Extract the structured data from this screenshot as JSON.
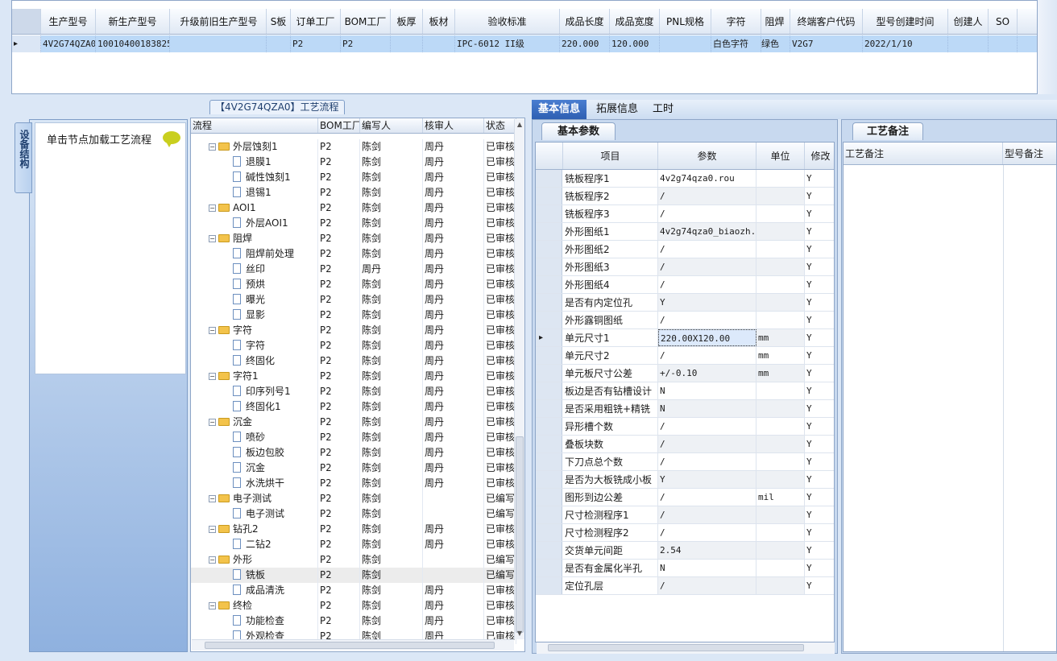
{
  "top_grid": {
    "headers": [
      "生产型号",
      "新生产型号",
      "升级前旧生产型号",
      "S板",
      "订单工厂",
      "BOM工厂",
      "板厚",
      "板材",
      "验收标准",
      "成品长度",
      "成品宽度",
      "PNL规格",
      "字符",
      "阻焊",
      "终端客户代码",
      "型号创建时间",
      "创建人",
      "SO"
    ],
    "row": [
      "4V2G74QZA0",
      "10010400183825",
      "",
      "",
      "P2",
      "P2",
      "",
      "",
      "IPC-6012 II级",
      "220.000",
      "120.000",
      "",
      "白色字符",
      "绿色",
      "V2G7",
      "2022/1/10",
      "",
      ""
    ]
  },
  "sidebar": {
    "tab_label": "设备结构",
    "hint_text": "单击节点加载工艺流程"
  },
  "process_tree": {
    "title": "【4V2G74QZA0】工艺流程",
    "headers": [
      "流程",
      "BOM工厂",
      "编写人",
      "核审人",
      "状态"
    ],
    "rows": [
      {
        "level": 1,
        "name": "外层蚀刻1",
        "bom": "P2",
        "author": "陈剑",
        "reviewer": "周丹",
        "status": "已审核"
      },
      {
        "level": 2,
        "name": "退膜1",
        "bom": "P2",
        "author": "陈剑",
        "reviewer": "周丹",
        "status": "已审核"
      },
      {
        "level": 2,
        "name": "碱性蚀刻1",
        "bom": "P2",
        "author": "陈剑",
        "reviewer": "周丹",
        "status": "已审核"
      },
      {
        "level": 2,
        "name": "退锡1",
        "bom": "P2",
        "author": "陈剑",
        "reviewer": "周丹",
        "status": "已审核"
      },
      {
        "level": 1,
        "name": "AOI1",
        "bom": "P2",
        "author": "陈剑",
        "reviewer": "周丹",
        "status": "已审核"
      },
      {
        "level": 2,
        "name": "外层AOI1",
        "bom": "P2",
        "author": "陈剑",
        "reviewer": "周丹",
        "status": "已审核"
      },
      {
        "level": 1,
        "name": "阻焊",
        "bom": "P2",
        "author": "陈剑",
        "reviewer": "周丹",
        "status": "已审核"
      },
      {
        "level": 2,
        "name": "阻焊前处理",
        "bom": "P2",
        "author": "陈剑",
        "reviewer": "周丹",
        "status": "已审核"
      },
      {
        "level": 2,
        "name": "丝印",
        "bom": "P2",
        "author": "周丹",
        "reviewer": "周丹",
        "status": "已审核"
      },
      {
        "level": 2,
        "name": "预烘",
        "bom": "P2",
        "author": "陈剑",
        "reviewer": "周丹",
        "status": "已审核"
      },
      {
        "level": 2,
        "name": "曝光",
        "bom": "P2",
        "author": "陈剑",
        "reviewer": "周丹",
        "status": "已审核"
      },
      {
        "level": 2,
        "name": "显影",
        "bom": "P2",
        "author": "陈剑",
        "reviewer": "周丹",
        "status": "已审核"
      },
      {
        "level": 1,
        "name": "字符",
        "bom": "P2",
        "author": "陈剑",
        "reviewer": "周丹",
        "status": "已审核"
      },
      {
        "level": 2,
        "name": "字符",
        "bom": "P2",
        "author": "陈剑",
        "reviewer": "周丹",
        "status": "已审核"
      },
      {
        "level": 2,
        "name": "终固化",
        "bom": "P2",
        "author": "陈剑",
        "reviewer": "周丹",
        "status": "已审核"
      },
      {
        "level": 1,
        "name": "字符1",
        "bom": "P2",
        "author": "陈剑",
        "reviewer": "周丹",
        "status": "已审核"
      },
      {
        "level": 2,
        "name": "印序列号1",
        "bom": "P2",
        "author": "陈剑",
        "reviewer": "周丹",
        "status": "已审核"
      },
      {
        "level": 2,
        "name": "终固化1",
        "bom": "P2",
        "author": "陈剑",
        "reviewer": "周丹",
        "status": "已审核"
      },
      {
        "level": 1,
        "name": "沉金",
        "bom": "P2",
        "author": "陈剑",
        "reviewer": "周丹",
        "status": "已审核"
      },
      {
        "level": 2,
        "name": "喷砂",
        "bom": "P2",
        "author": "陈剑",
        "reviewer": "周丹",
        "status": "已审核"
      },
      {
        "level": 2,
        "name": "板边包胶",
        "bom": "P2",
        "author": "陈剑",
        "reviewer": "周丹",
        "status": "已审核"
      },
      {
        "level": 2,
        "name": "沉金",
        "bom": "P2",
        "author": "陈剑",
        "reviewer": "周丹",
        "status": "已审核"
      },
      {
        "level": 2,
        "name": "水洗烘干",
        "bom": "P2",
        "author": "陈剑",
        "reviewer": "周丹",
        "status": "已审核"
      },
      {
        "level": 1,
        "name": "电子测试",
        "bom": "P2",
        "author": "陈剑",
        "reviewer": "",
        "status": "已编写"
      },
      {
        "level": 2,
        "name": "电子测试",
        "bom": "P2",
        "author": "陈剑",
        "reviewer": "",
        "status": "已编写"
      },
      {
        "level": 1,
        "name": "钻孔2",
        "bom": "P2",
        "author": "陈剑",
        "reviewer": "周丹",
        "status": "已审核"
      },
      {
        "level": 2,
        "name": "二钻2",
        "bom": "P2",
        "author": "陈剑",
        "reviewer": "周丹",
        "status": "已审核"
      },
      {
        "level": 1,
        "name": "外形",
        "bom": "P2",
        "author": "陈剑",
        "reviewer": "",
        "status": "已编写"
      },
      {
        "level": 2,
        "name": "铣板",
        "bom": "P2",
        "author": "陈剑",
        "reviewer": "",
        "status": "已编写"
      },
      {
        "level": 2,
        "name": "成品清洗",
        "bom": "P2",
        "author": "陈剑",
        "reviewer": "周丹",
        "status": "已审核"
      },
      {
        "level": 1,
        "name": "终检",
        "bom": "P2",
        "author": "陈剑",
        "reviewer": "周丹",
        "status": "已审核"
      },
      {
        "level": 2,
        "name": "功能检查",
        "bom": "P2",
        "author": "陈剑",
        "reviewer": "周丹",
        "status": "已审核"
      },
      {
        "level": 2,
        "name": "外观检查",
        "bom": "P2",
        "author": "陈剑",
        "reviewer": "周丹",
        "status": "已审核"
      }
    ]
  },
  "right_tabs": [
    "基本信息",
    "拓展信息",
    "工时"
  ],
  "basic_params": {
    "tab_label": "基本参数",
    "headers": [
      "项目",
      "参数",
      "单位",
      "修改"
    ],
    "rows": [
      {
        "item": "铣板程序1",
        "value": "4v2g74qza0.rou",
        "unit": "",
        "flag": "Y"
      },
      {
        "item": "铣板程序2",
        "value": "/",
        "unit": "",
        "flag": "Y"
      },
      {
        "item": "铣板程序3",
        "value": "/",
        "unit": "",
        "flag": "Y"
      },
      {
        "item": "外形图纸1",
        "value": "4v2g74qza0_biaozh...",
        "unit": "",
        "flag": "Y"
      },
      {
        "item": "外形图纸2",
        "value": "/",
        "unit": "",
        "flag": "Y"
      },
      {
        "item": "外形图纸3",
        "value": "/",
        "unit": "",
        "flag": "Y"
      },
      {
        "item": "外形图纸4",
        "value": "/",
        "unit": "",
        "flag": "Y"
      },
      {
        "item": "是否有内定位孔",
        "value": "Y",
        "unit": "",
        "flag": "Y"
      },
      {
        "item": "外形露铜图纸",
        "value": "/",
        "unit": "",
        "flag": "Y"
      },
      {
        "item": "单元尺寸1",
        "value": "220.00X120.00",
        "unit": "mm",
        "flag": "Y"
      },
      {
        "item": "单元尺寸2",
        "value": "/",
        "unit": "mm",
        "flag": "Y"
      },
      {
        "item": "单元板尺寸公差",
        "value": "+/-0.10",
        "unit": "mm",
        "flag": "Y"
      },
      {
        "item": "板边是否有钻槽设计",
        "value": "N",
        "unit": "",
        "flag": "Y"
      },
      {
        "item": "是否采用粗铣+精铣",
        "value": "N",
        "unit": "",
        "flag": "Y"
      },
      {
        "item": "异形槽个数",
        "value": "/",
        "unit": "",
        "flag": "Y"
      },
      {
        "item": "叠板块数",
        "value": "/",
        "unit": "",
        "flag": "Y"
      },
      {
        "item": "下刀点总个数",
        "value": "/",
        "unit": "",
        "flag": "Y"
      },
      {
        "item": "是否为大板铣成小板",
        "value": "Y",
        "unit": "",
        "flag": "Y"
      },
      {
        "item": "图形到边公差",
        "value": "/",
        "unit": "mil",
        "flag": "Y"
      },
      {
        "item": "尺寸检测程序1",
        "value": "/",
        "unit": "",
        "flag": "Y"
      },
      {
        "item": "尺寸检测程序2",
        "value": "/",
        "unit": "",
        "flag": "Y"
      },
      {
        "item": "交货单元间距",
        "value": "2.54",
        "unit": "",
        "flag": "Y"
      },
      {
        "item": "是否有金属化半孔",
        "value": "N",
        "unit": "",
        "flag": "Y"
      },
      {
        "item": "定位孔层",
        "value": "/",
        "unit": "",
        "flag": "Y"
      }
    ]
  },
  "remarks": {
    "tab_label": "工艺备注",
    "headers": [
      "工艺备注",
      "型号备注"
    ]
  },
  "colors": {
    "accent": "#2e5fb2",
    "selected_row": "#bcd9f7",
    "folder": "#f3c34b"
  }
}
